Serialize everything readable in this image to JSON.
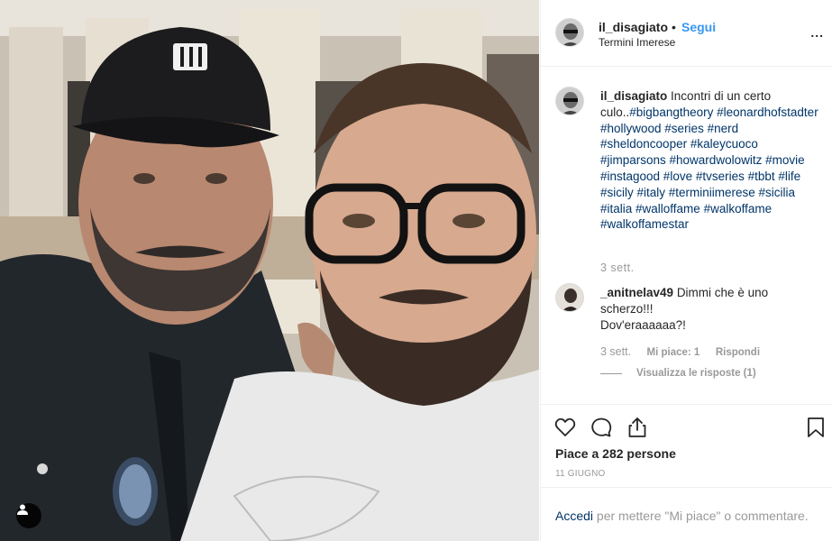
{
  "post": {
    "header": {
      "username": "il_disagiato",
      "separator": "•",
      "follow_label": "Segui",
      "location": "Termini Imerese",
      "more_label": "..."
    },
    "caption": {
      "username": "il_disagiato",
      "text": "Incontri di un certo culo..",
      "hashtags": "#bigbangtheory #leonardhofstadter #hollywood #series #nerd #sheldoncooper #kaleycuoco #jimparsons #howardwolowitz #movie #instagood #love #tvseries #tbbt #life #sicily #italy #terminiimerese #sicilia #italia #walloffame #walkoffame #walkoffamestar",
      "time": "3 sett."
    },
    "comment": {
      "username": "_anitnelav49",
      "text": "Dimmi che è uno scherzo!!!",
      "text2": "Dov'eraaaaaa?!",
      "time": "3 sett.",
      "likes": "Mi piace: 1",
      "reply": "Rispondi",
      "view_replies": "Visualizza le risposte (1)"
    },
    "actions": {
      "icons": [
        "heart-icon",
        "comment-icon",
        "share-icon",
        "bookmark-icon"
      ],
      "likes_text": "Piace a 282 persone",
      "date": "11 GIUGNO"
    },
    "add_comment": {
      "login_label": "Accedi",
      "rest_text": " per mettere \"Mi piace\" o commentare."
    }
  },
  "colors": {
    "link_blue": "#3897f0",
    "hashtag_blue": "#003569",
    "muted": "#999999",
    "text": "#262626"
  }
}
